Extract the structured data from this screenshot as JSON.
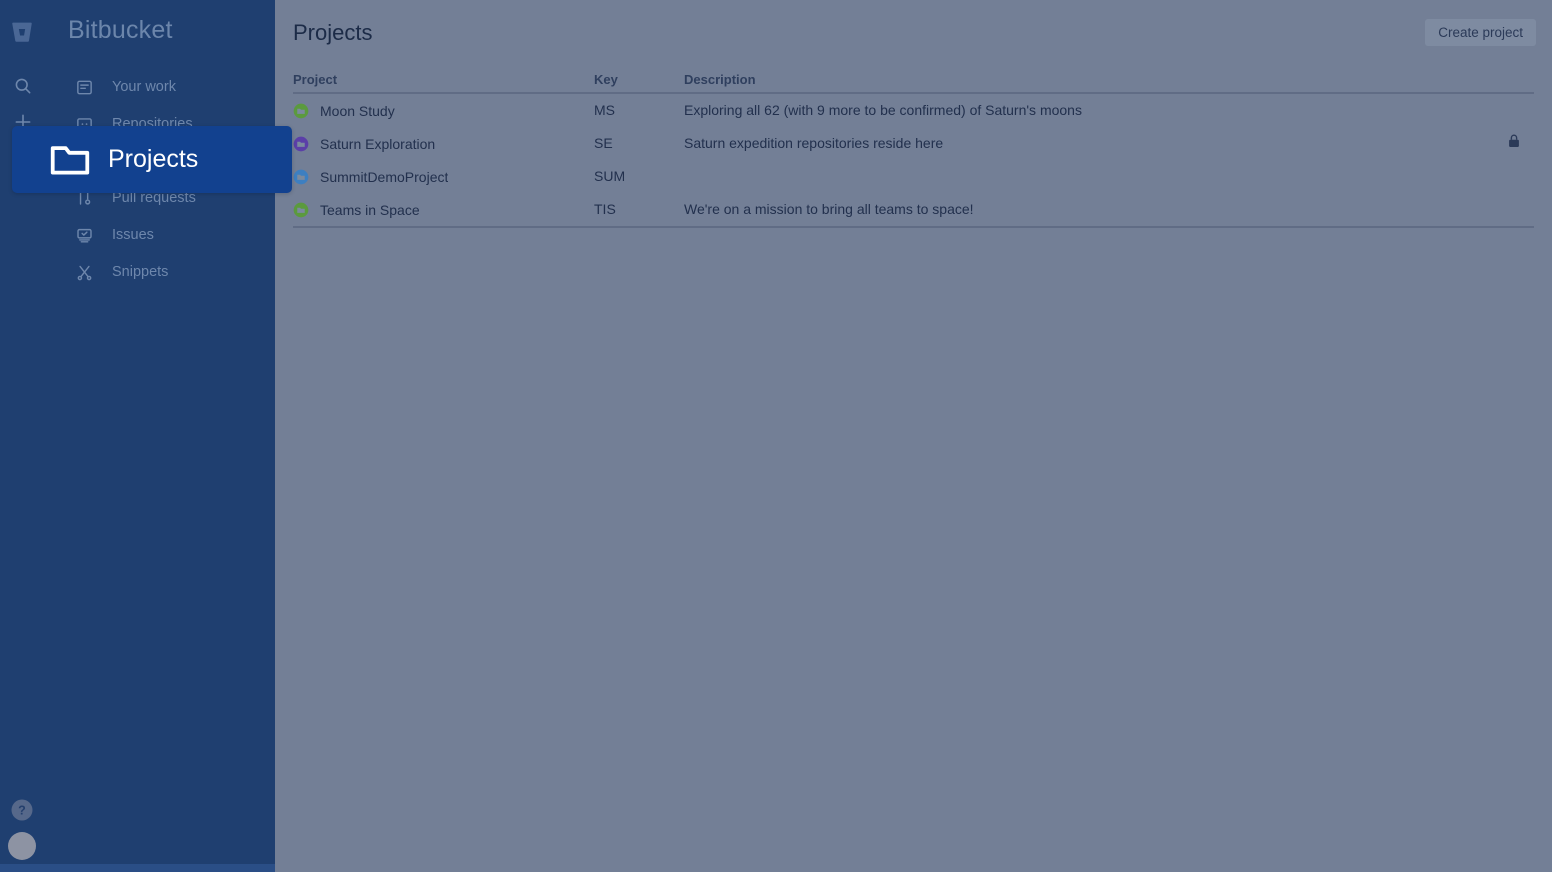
{
  "sidebar": {
    "brand": {
      "logo_icon": "bitbucket-logo-icon",
      "name": "Bitbucket"
    },
    "rail": [
      {
        "icon": "search-icon",
        "name": "search"
      },
      {
        "icon": "plus-icon",
        "name": "create"
      }
    ],
    "items": [
      {
        "label": "Your work",
        "icon": "your-work-icon"
      },
      {
        "label": "Repositories",
        "icon": "repositories-icon"
      },
      {
        "label": "Projects",
        "icon": "projects-folder-icon"
      },
      {
        "label": "Pull requests",
        "icon": "pull-requests-icon"
      },
      {
        "label": "Issues",
        "icon": "issues-icon"
      },
      {
        "label": "Snippets",
        "icon": "snippets-icon"
      }
    ],
    "help": {
      "label": "?",
      "icon": "help-circle-icon"
    },
    "avatar": {
      "icon": "user-avatar-icon"
    }
  },
  "tooltip": {
    "label": "Projects",
    "icon": "folder-icon",
    "background": "#12418f"
  },
  "header": {
    "title": "Projects",
    "create_button_label": "Create project"
  },
  "table": {
    "columns": [
      "Project",
      "Key",
      "Description"
    ],
    "rows": [
      {
        "project": "Moon Study",
        "key": "MS",
        "description": "Exploring all 62 (with 9 more to be confirmed) of Saturn's moons",
        "avatar_color": "#5b9a3e",
        "private": false
      },
      {
        "project": "Saturn Exploration",
        "key": "SE",
        "description": "Saturn expedition repositories reside here",
        "avatar_color": "#5b3fa8",
        "private": true
      },
      {
        "project": "SummitDemoProject",
        "key": "SUM",
        "description": "",
        "avatar_color": "#3d7fc1",
        "private": false
      },
      {
        "project": "Teams in Space",
        "key": "TIS",
        "description": "We're on a mission to bring all teams to space!",
        "avatar_color": "#5b9a3e",
        "private": false
      }
    ]
  },
  "colors": {
    "sidebar_bg": "#1f3f70",
    "main_bg": "#737f96",
    "tooltip_bg": "#12418f",
    "title_text": "#1c2b47"
  }
}
